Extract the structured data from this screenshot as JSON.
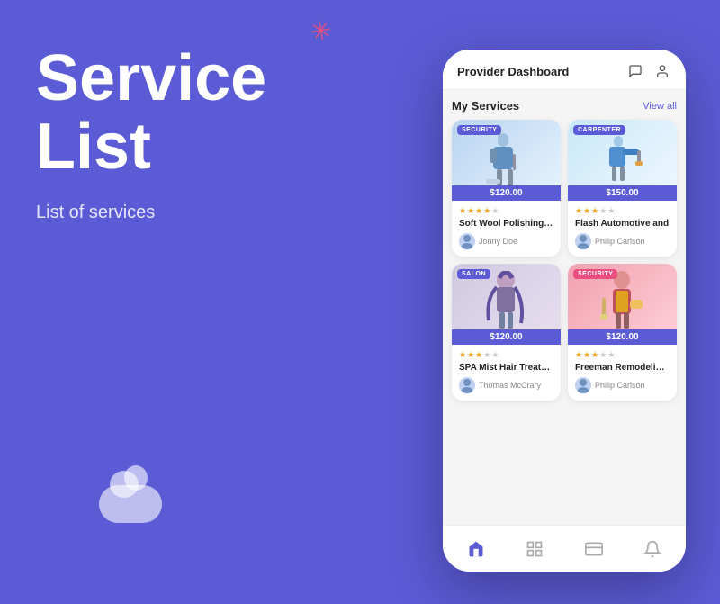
{
  "background_color": "#5b5bd6",
  "star_icon": "✳",
  "left_panel": {
    "title_line1": "Service",
    "title_line2": "List",
    "subtitle": "List of services"
  },
  "phone": {
    "header": {
      "title": "Provider Dashboard",
      "chat_icon": "💬",
      "user_icon": "👤"
    },
    "services_section": {
      "title": "My Services",
      "view_all_label": "View all"
    },
    "cards": [
      {
        "id": "card-1",
        "tag": "SECURITY",
        "tag_color": "blue",
        "price": "$120.00",
        "stars": 4,
        "name": "Soft Wool Polishing Ho",
        "provider_name": "Jonny Doe",
        "image_type": "cleaner"
      },
      {
        "id": "card-2",
        "tag": "CARPENTER",
        "tag_color": "blue",
        "price": "$150.00",
        "stars": 3,
        "name": "Flash Automotive and",
        "provider_name": "Philip Carlson",
        "image_type": "painter"
      },
      {
        "id": "card-3",
        "tag": "SALON",
        "tag_color": "blue",
        "price": "$120.00",
        "stars": 3,
        "name": "SPA Mist Hair Treatme",
        "provider_name": "Thomas McCrary",
        "image_type": "salon"
      },
      {
        "id": "card-4",
        "tag": "SECURITY",
        "tag_color": "red",
        "price": "$120.00",
        "stars": 3,
        "name": "Freeman Remodeling a",
        "provider_name": "Philip Carlson",
        "image_type": "security"
      }
    ],
    "nav": [
      {
        "icon": "🏠",
        "active": true,
        "label": "home"
      },
      {
        "icon": "⊞",
        "active": false,
        "label": "grid"
      },
      {
        "icon": "💳",
        "active": false,
        "label": "wallet"
      },
      {
        "icon": "🔔",
        "active": false,
        "label": "notifications"
      }
    ]
  }
}
